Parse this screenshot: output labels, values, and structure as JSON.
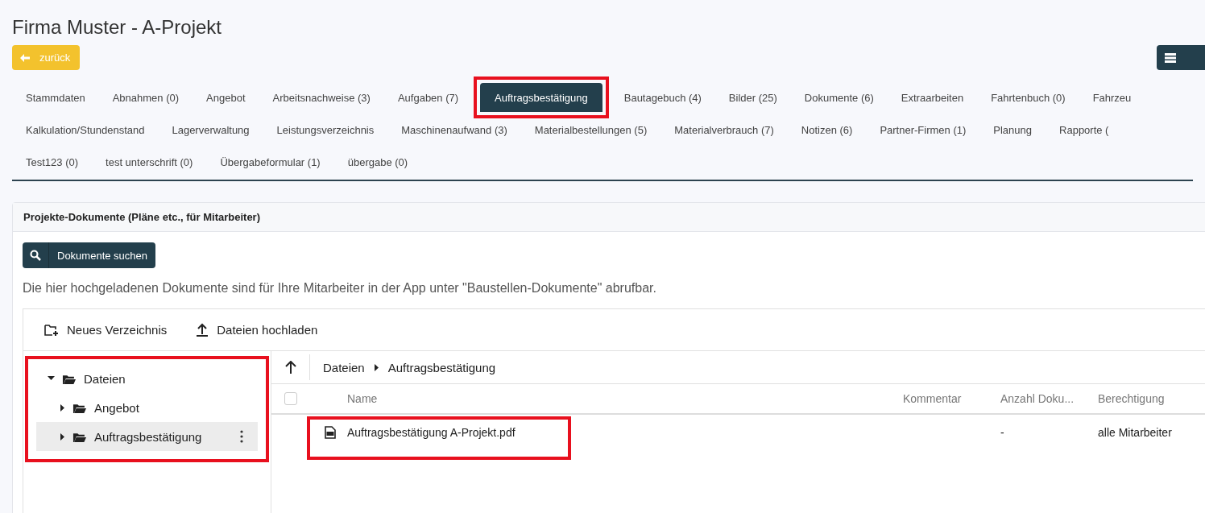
{
  "header": {
    "title": "Firma Muster - A-Projekt",
    "back_button": "zurück"
  },
  "tab_rows": [
    [
      {
        "label": "Stammdaten",
        "selected": false,
        "highlighted": false
      },
      {
        "label": "Abnahmen (0)",
        "selected": false,
        "highlighted": false
      },
      {
        "label": "Angebot",
        "selected": false,
        "highlighted": false
      },
      {
        "label": "Arbeitsnachweise (3)",
        "selected": false,
        "highlighted": false
      },
      {
        "label": "Aufgaben (7)",
        "selected": false,
        "highlighted": false
      },
      {
        "label": "Auftragsbestätigung",
        "selected": true,
        "highlighted": true
      },
      {
        "label": "Bautagebuch (4)",
        "selected": false,
        "highlighted": false
      },
      {
        "label": "Bilder (25)",
        "selected": false,
        "highlighted": false
      },
      {
        "label": "Dokumente (6)",
        "selected": false,
        "highlighted": false
      },
      {
        "label": "Extraarbeiten",
        "selected": false,
        "highlighted": false
      },
      {
        "label": "Fahrtenbuch (0)",
        "selected": false,
        "highlighted": false
      },
      {
        "label": "Fahrzeu",
        "selected": false,
        "highlighted": false
      }
    ],
    [
      {
        "label": "Kalkulation/Stundenstand",
        "selected": false,
        "highlighted": false
      },
      {
        "label": "Lagerverwaltung",
        "selected": false,
        "highlighted": false
      },
      {
        "label": "Leistungsverzeichnis",
        "selected": false,
        "highlighted": false
      },
      {
        "label": "Maschinenaufwand (3)",
        "selected": false,
        "highlighted": false
      },
      {
        "label": "Materialbestellungen (5)",
        "selected": false,
        "highlighted": false
      },
      {
        "label": "Materialverbrauch (7)",
        "selected": false,
        "highlighted": false
      },
      {
        "label": "Notizen (6)",
        "selected": false,
        "highlighted": false
      },
      {
        "label": "Partner-Firmen (1)",
        "selected": false,
        "highlighted": false
      },
      {
        "label": "Planung",
        "selected": false,
        "highlighted": false
      },
      {
        "label": "Rapporte (",
        "selected": false,
        "highlighted": false
      }
    ],
    [
      {
        "label": "Test123 (0)",
        "selected": false,
        "highlighted": false
      },
      {
        "label": "test unterschrift (0)",
        "selected": false,
        "highlighted": false
      },
      {
        "label": "Übergabeformular (1)",
        "selected": false,
        "highlighted": false
      },
      {
        "label": "übergabe (0)",
        "selected": false,
        "highlighted": false
      }
    ]
  ],
  "card": {
    "title": "Projekte-Dokumente (Pläne etc., für Mitarbeiter)",
    "search_button": "Dokumente suchen",
    "description": "Die hier hochgeladenen Dokumente sind für Ihre Mitarbeiter in der App unter \"Baustellen-Dokumente\" abrufbar."
  },
  "file_manager": {
    "toolbar": [
      "Neues Verzeichnis",
      "Dateien hochladen"
    ],
    "tree": {
      "highlighted": true,
      "items": [
        {
          "label": "Dateien",
          "expanded": true,
          "selected": false,
          "children": [
            {
              "label": "Angebot",
              "expanded": false,
              "selected": false
            },
            {
              "label": "Auftragsbestätigung",
              "expanded": false,
              "selected": true
            }
          ]
        }
      ]
    },
    "breadcrumb": [
      "Dateien",
      "Auftragsbestätigung"
    ],
    "select_all_checked": false,
    "columns": [
      "Name",
      "Kommentar",
      "Anzahl Doku...",
      "Berechtigung"
    ],
    "rows": [
      {
        "name": "Auftragsbestätigung A-Projekt.pdf",
        "comment": "",
        "count": "-",
        "permission": "alle Mitarbeiter",
        "highlighted": true
      }
    ]
  }
}
